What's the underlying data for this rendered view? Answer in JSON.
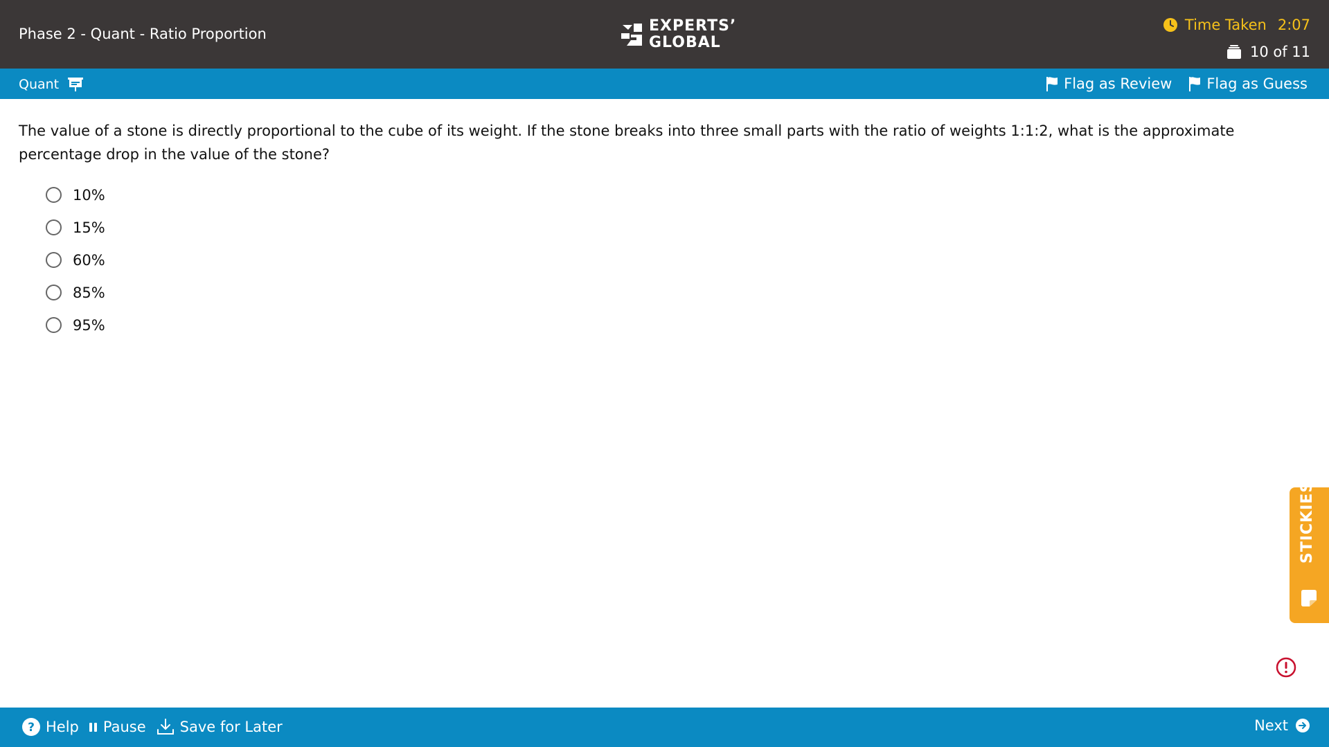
{
  "header": {
    "title": "Phase 2 - Quant - Ratio Proportion",
    "logo_line1": "EXPERTS’",
    "logo_line2": "GLOBAL",
    "timer_label": "Time Taken",
    "timer_value": "2:07",
    "progress": "10 of 11"
  },
  "subheader": {
    "section": "Quant",
    "flag_review": "Flag as Review",
    "flag_guess": "Flag as Guess"
  },
  "question": {
    "text": "The value of a stone is directly proportional to the cube of its weight. If the stone breaks into three small parts with the ratio of weights 1:1:2, what is the approximate percentage drop in the value of the stone?",
    "options": [
      "10%",
      "15%",
      "60%",
      "85%",
      "95%"
    ]
  },
  "stickies": {
    "label": "STICKIES"
  },
  "footer": {
    "help": "Help",
    "pause": "Pause",
    "save": "Save for Later",
    "next": "Next"
  },
  "colors": {
    "header_bg": "#3b3737",
    "accent_blue": "#0b8ac2",
    "timer_yellow": "#f6c11a",
    "stickies_orange": "#f5a623",
    "alert_red": "#c8102e"
  }
}
